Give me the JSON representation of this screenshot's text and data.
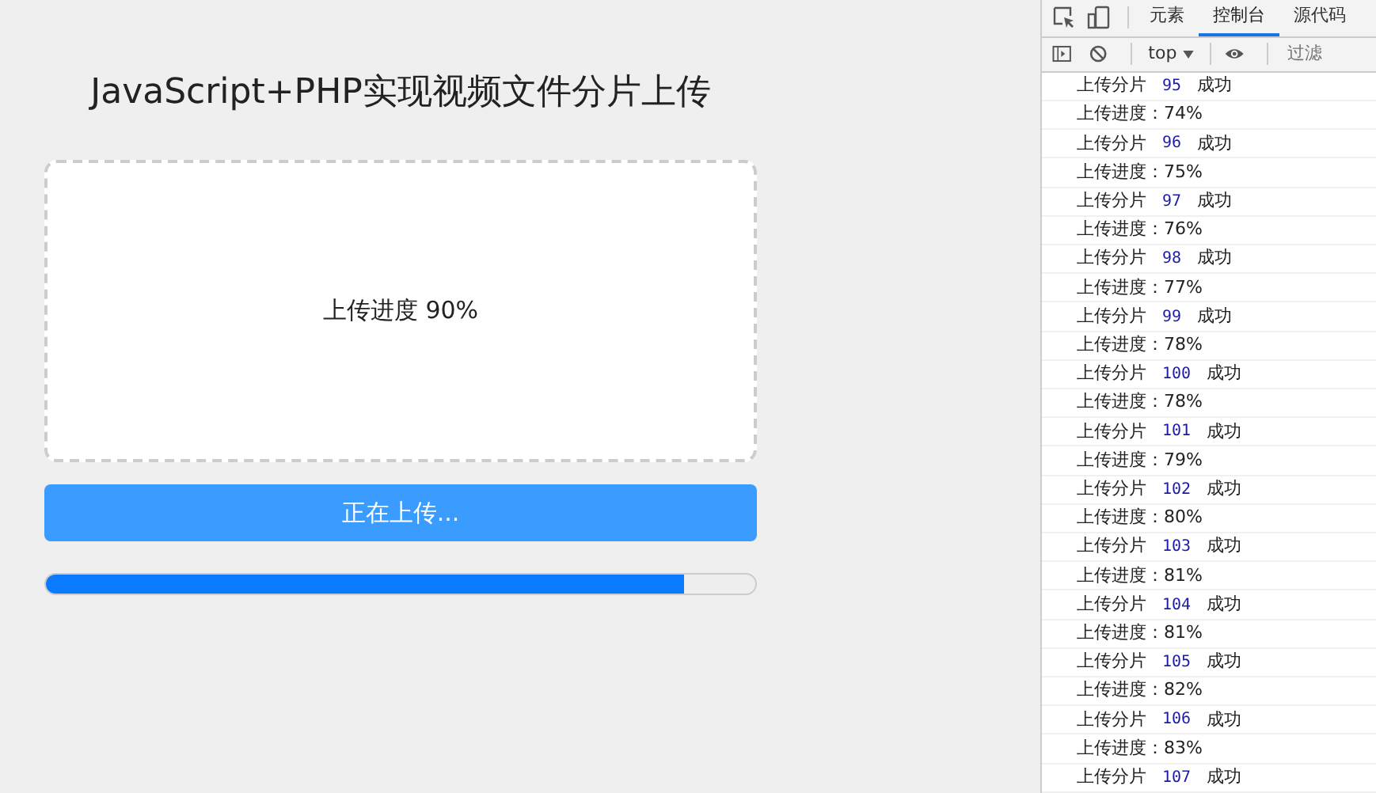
{
  "page": {
    "title": "JavaScript+PHP实现视频文件分片上传",
    "dropzone_text": "上传进度 90%",
    "upload_button": {
      "label": "正在上传..."
    },
    "progress": {
      "level": 0.9
    }
  },
  "devtools": {
    "tabs": [
      {
        "label": "元素",
        "selected": false
      },
      {
        "label": "控制台",
        "selected": true
      },
      {
        "label": "源代码",
        "selected": false
      }
    ],
    "context": "top",
    "filter": {
      "placeholder": "过滤"
    },
    "log": [
      {
        "kind": "chunk",
        "label": "上传分片",
        "number": "95",
        "status": "成功"
      },
      {
        "kind": "progress",
        "text": "上传进度：74%"
      },
      {
        "kind": "chunk",
        "label": "上传分片",
        "number": "96",
        "status": "成功"
      },
      {
        "kind": "progress",
        "text": "上传进度：75%"
      },
      {
        "kind": "chunk",
        "label": "上传分片",
        "number": "97",
        "status": "成功"
      },
      {
        "kind": "progress",
        "text": "上传进度：76%"
      },
      {
        "kind": "chunk",
        "label": "上传分片",
        "number": "98",
        "status": "成功"
      },
      {
        "kind": "progress",
        "text": "上传进度：77%"
      },
      {
        "kind": "chunk",
        "label": "上传分片",
        "number": "99",
        "status": "成功"
      },
      {
        "kind": "progress",
        "text": "上传进度：78%"
      },
      {
        "kind": "chunk",
        "label": "上传分片",
        "number": "100",
        "status": "成功"
      },
      {
        "kind": "progress",
        "text": "上传进度：78%"
      },
      {
        "kind": "chunk",
        "label": "上传分片",
        "number": "101",
        "status": "成功"
      },
      {
        "kind": "progress",
        "text": "上传进度：79%"
      },
      {
        "kind": "chunk",
        "label": "上传分片",
        "number": "102",
        "status": "成功"
      },
      {
        "kind": "progress",
        "text": "上传进度：80%"
      },
      {
        "kind": "chunk",
        "label": "上传分片",
        "number": "103",
        "status": "成功"
      },
      {
        "kind": "progress",
        "text": "上传进度：81%"
      },
      {
        "kind": "chunk",
        "label": "上传分片",
        "number": "104",
        "status": "成功"
      },
      {
        "kind": "progress",
        "text": "上传进度：81%"
      },
      {
        "kind": "chunk",
        "label": "上传分片",
        "number": "105",
        "status": "成功"
      },
      {
        "kind": "progress",
        "text": "上传进度：82%"
      },
      {
        "kind": "chunk",
        "label": "上传分片",
        "number": "106",
        "status": "成功"
      },
      {
        "kind": "progress",
        "text": "上传进度：83%"
      },
      {
        "kind": "chunk",
        "label": "上传分片",
        "number": "107",
        "status": "成功"
      }
    ]
  }
}
